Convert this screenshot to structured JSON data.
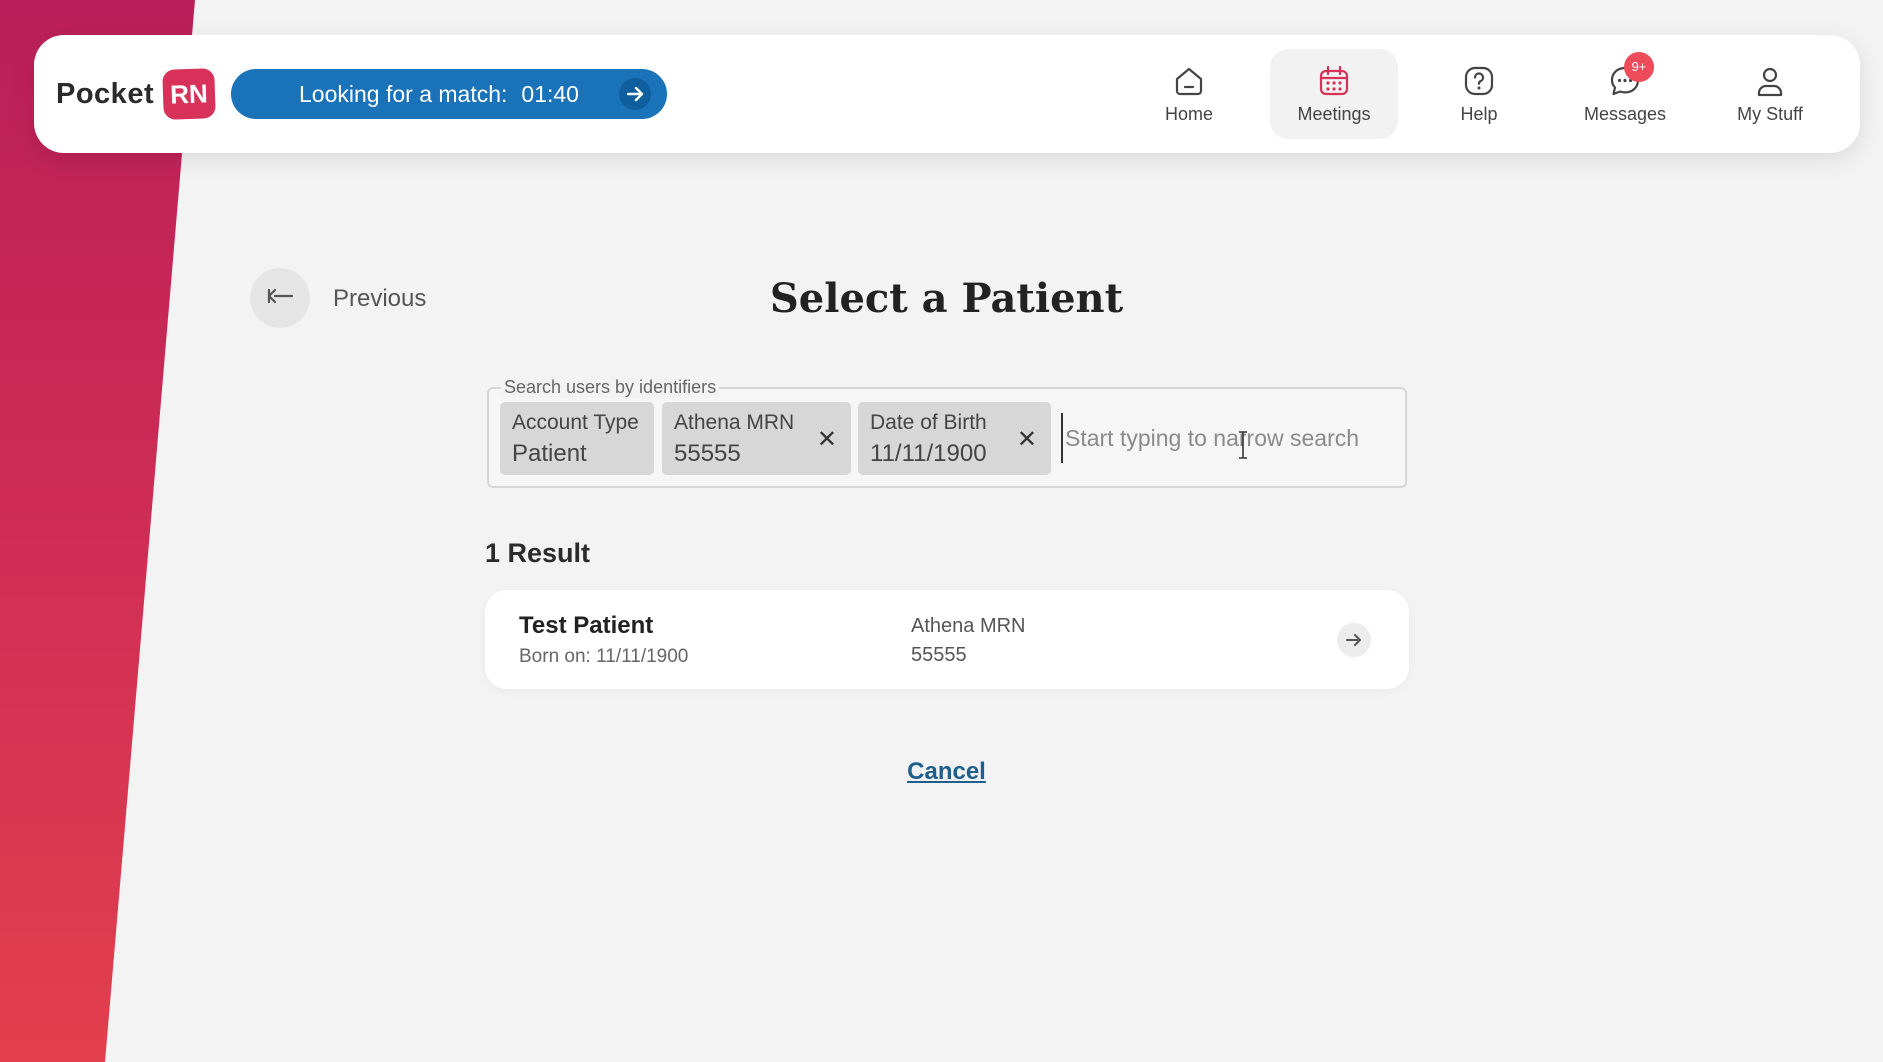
{
  "brand": {
    "name": "Pocket",
    "badge": "RN",
    "accent": "#d8325a"
  },
  "match": {
    "label": "Looking for a match:",
    "time": "01:40",
    "color": "#1a73b9"
  },
  "nav": {
    "items": [
      {
        "label": "Home",
        "icon": "home-icon"
      },
      {
        "label": "Meetings",
        "icon": "calendar-icon",
        "active": true
      },
      {
        "label": "Help",
        "icon": "help-icon"
      },
      {
        "label": "Messages",
        "icon": "chat-icon",
        "badge": "9+"
      },
      {
        "label": "My Stuff",
        "icon": "user-icon"
      }
    ]
  },
  "page": {
    "previous_label": "Previous",
    "title": "Select a Patient"
  },
  "search": {
    "legend": "Search users by identifiers",
    "placeholder": "Start typing to narrow search",
    "chips": [
      {
        "key": "Account Type",
        "value": "Patient",
        "removable": false
      },
      {
        "key": "Athena MRN",
        "value": "55555",
        "removable": true
      },
      {
        "key": "Date of Birth",
        "value": "11/11/1900",
        "removable": true
      }
    ]
  },
  "results": {
    "count_label": "1 Result",
    "items": [
      {
        "name": "Test Patient",
        "born": "Born on: 11/11/1900",
        "id_key": "Athena MRN",
        "id_value": "55555"
      }
    ]
  },
  "cancel_label": "Cancel"
}
